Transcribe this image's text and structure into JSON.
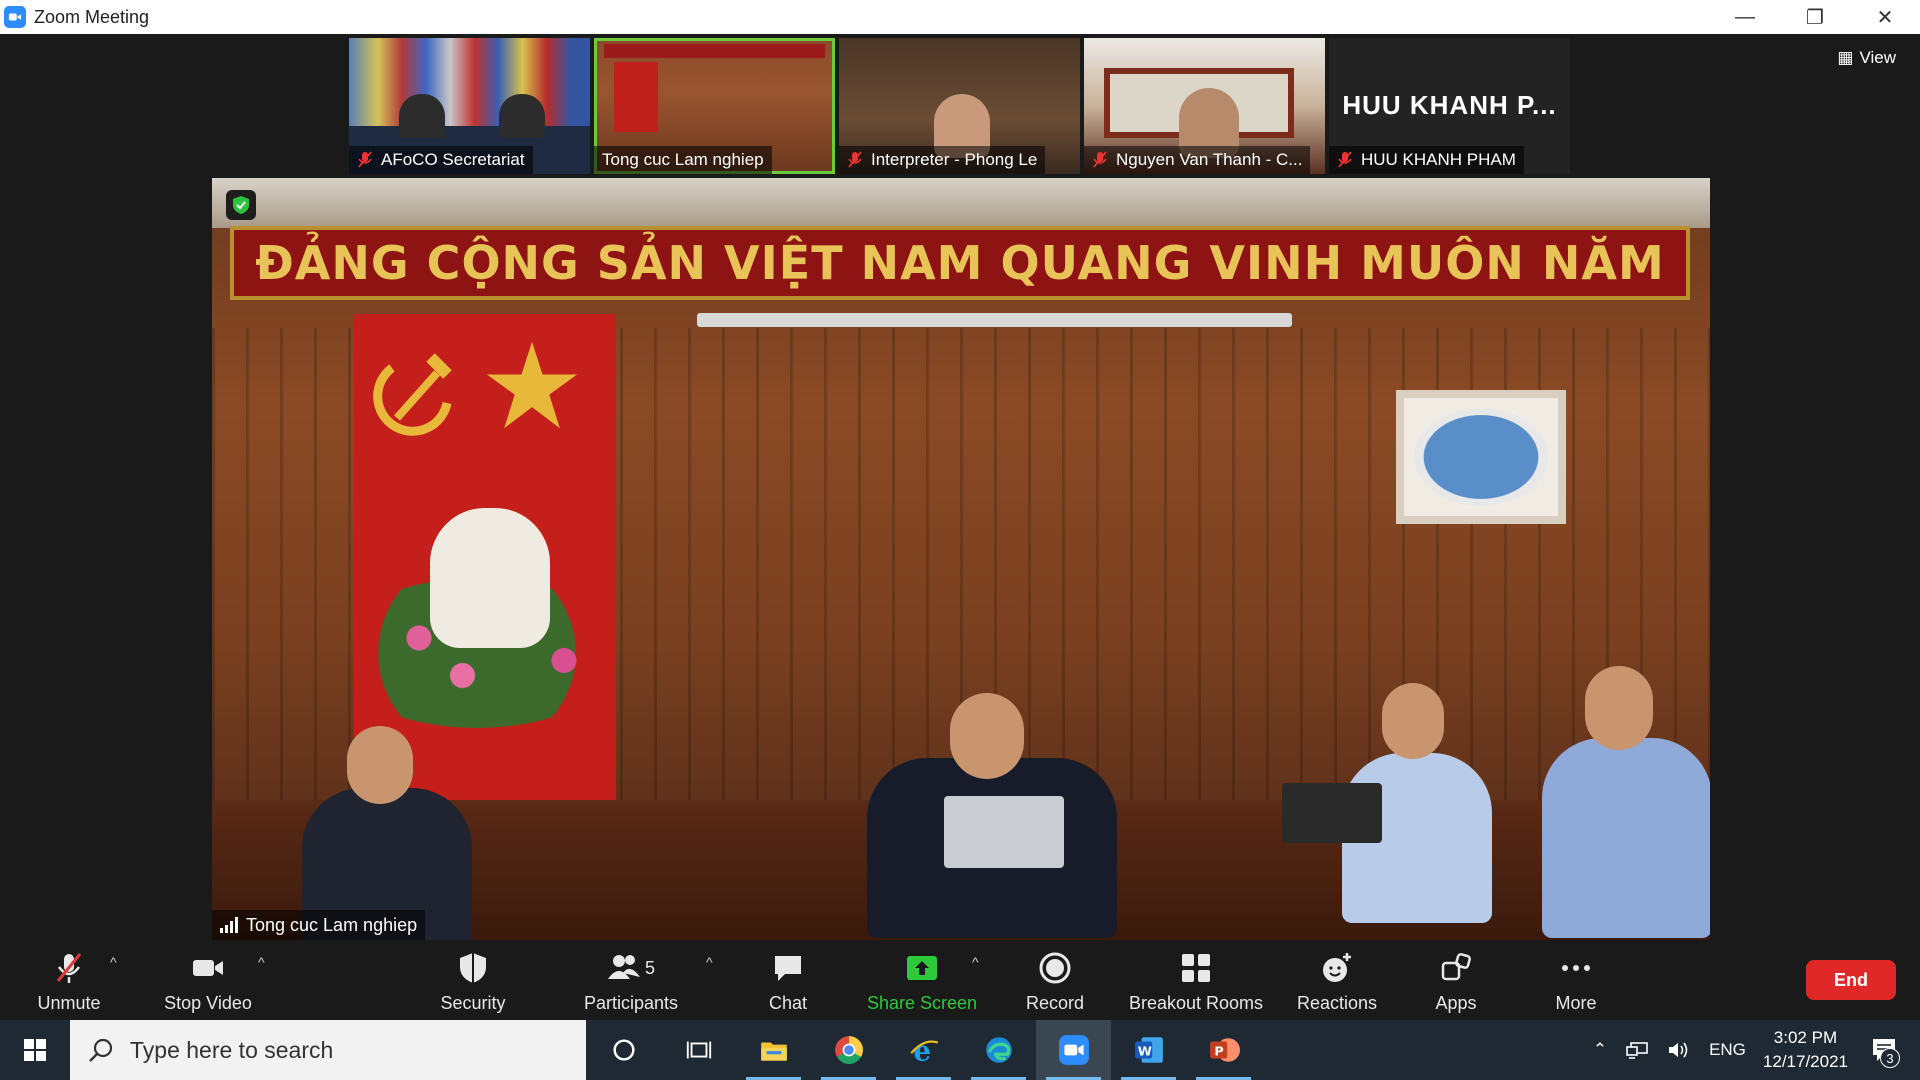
{
  "window": {
    "title": "Zoom Meeting"
  },
  "view_button": {
    "label": "View"
  },
  "thumbnails": [
    {
      "name": "AFoCO Secretariat",
      "muted": true
    },
    {
      "name": "Tong cuc Lam nghiep",
      "muted": false,
      "active": true
    },
    {
      "name": "Interpreter - Phong Le",
      "muted": true
    },
    {
      "name": "Nguyen Van Thanh - C...",
      "muted": true
    },
    {
      "name": "HUU KHANH PHAM",
      "display_text": "HUU KHANH P...",
      "muted": true
    }
  ],
  "main_video": {
    "speaker": "Tong cuc Lam nghiep",
    "banner_text": "ĐẢNG CỘNG SẢN VIỆT NAM QUANG VINH MUÔN NĂM"
  },
  "toolbar": {
    "unmute": "Unmute",
    "stop_video": "Stop Video",
    "security": "Security",
    "participants": "Participants",
    "participants_count": "5",
    "chat": "Chat",
    "share_screen": "Share Screen",
    "record": "Record",
    "breakout_rooms": "Breakout Rooms",
    "reactions": "Reactions",
    "apps": "Apps",
    "more": "More",
    "end": "End"
  },
  "taskbar": {
    "search_placeholder": "Type here to search",
    "apps": [
      "cortana-icon",
      "task-view-icon",
      "file-explorer-icon",
      "chrome-icon",
      "internet-explorer-icon",
      "edge-icon",
      "zoom-icon",
      "word-icon",
      "powerpoint-icon"
    ],
    "language": "ENG",
    "time": "3:02 PM",
    "date": "12/17/2021",
    "notification_count": "3"
  },
  "colors": {
    "accent": "#2d8cff",
    "share_green": "#2dca3c",
    "end_red": "#e02828",
    "active_border": "#6ccb3a"
  }
}
